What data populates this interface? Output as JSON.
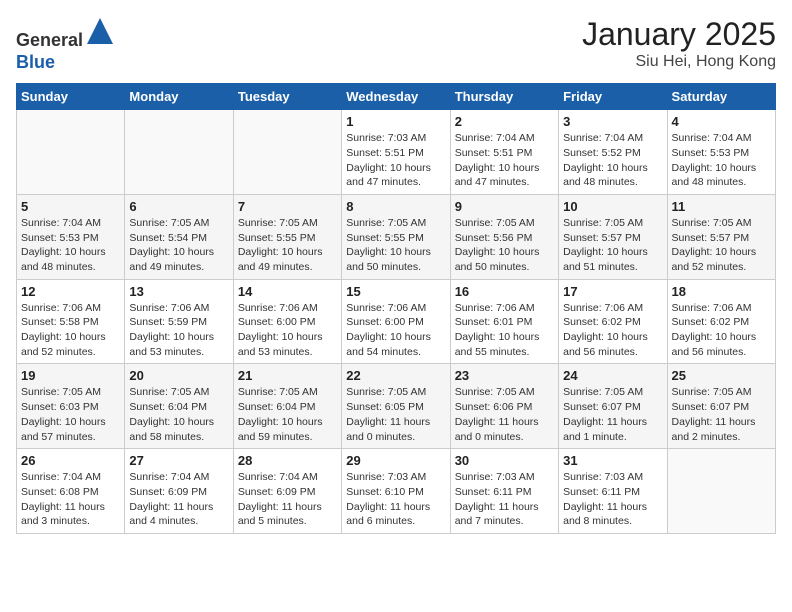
{
  "header": {
    "logo_line1": "General",
    "logo_line2": "Blue",
    "month": "January 2025",
    "location": "Siu Hei, Hong Kong"
  },
  "weekdays": [
    "Sunday",
    "Monday",
    "Tuesday",
    "Wednesday",
    "Thursday",
    "Friday",
    "Saturday"
  ],
  "weeks": [
    [
      {
        "day": "",
        "info": ""
      },
      {
        "day": "",
        "info": ""
      },
      {
        "day": "",
        "info": ""
      },
      {
        "day": "1",
        "info": "Sunrise: 7:03 AM\nSunset: 5:51 PM\nDaylight: 10 hours\nand 47 minutes."
      },
      {
        "day": "2",
        "info": "Sunrise: 7:04 AM\nSunset: 5:51 PM\nDaylight: 10 hours\nand 47 minutes."
      },
      {
        "day": "3",
        "info": "Sunrise: 7:04 AM\nSunset: 5:52 PM\nDaylight: 10 hours\nand 48 minutes."
      },
      {
        "day": "4",
        "info": "Sunrise: 7:04 AM\nSunset: 5:53 PM\nDaylight: 10 hours\nand 48 minutes."
      }
    ],
    [
      {
        "day": "5",
        "info": "Sunrise: 7:04 AM\nSunset: 5:53 PM\nDaylight: 10 hours\nand 48 minutes."
      },
      {
        "day": "6",
        "info": "Sunrise: 7:05 AM\nSunset: 5:54 PM\nDaylight: 10 hours\nand 49 minutes."
      },
      {
        "day": "7",
        "info": "Sunrise: 7:05 AM\nSunset: 5:55 PM\nDaylight: 10 hours\nand 49 minutes."
      },
      {
        "day": "8",
        "info": "Sunrise: 7:05 AM\nSunset: 5:55 PM\nDaylight: 10 hours\nand 50 minutes."
      },
      {
        "day": "9",
        "info": "Sunrise: 7:05 AM\nSunset: 5:56 PM\nDaylight: 10 hours\nand 50 minutes."
      },
      {
        "day": "10",
        "info": "Sunrise: 7:05 AM\nSunset: 5:57 PM\nDaylight: 10 hours\nand 51 minutes."
      },
      {
        "day": "11",
        "info": "Sunrise: 7:05 AM\nSunset: 5:57 PM\nDaylight: 10 hours\nand 52 minutes."
      }
    ],
    [
      {
        "day": "12",
        "info": "Sunrise: 7:06 AM\nSunset: 5:58 PM\nDaylight: 10 hours\nand 52 minutes."
      },
      {
        "day": "13",
        "info": "Sunrise: 7:06 AM\nSunset: 5:59 PM\nDaylight: 10 hours\nand 53 minutes."
      },
      {
        "day": "14",
        "info": "Sunrise: 7:06 AM\nSunset: 6:00 PM\nDaylight: 10 hours\nand 53 minutes."
      },
      {
        "day": "15",
        "info": "Sunrise: 7:06 AM\nSunset: 6:00 PM\nDaylight: 10 hours\nand 54 minutes."
      },
      {
        "day": "16",
        "info": "Sunrise: 7:06 AM\nSunset: 6:01 PM\nDaylight: 10 hours\nand 55 minutes."
      },
      {
        "day": "17",
        "info": "Sunrise: 7:06 AM\nSunset: 6:02 PM\nDaylight: 10 hours\nand 56 minutes."
      },
      {
        "day": "18",
        "info": "Sunrise: 7:06 AM\nSunset: 6:02 PM\nDaylight: 10 hours\nand 56 minutes."
      }
    ],
    [
      {
        "day": "19",
        "info": "Sunrise: 7:05 AM\nSunset: 6:03 PM\nDaylight: 10 hours\nand 57 minutes."
      },
      {
        "day": "20",
        "info": "Sunrise: 7:05 AM\nSunset: 6:04 PM\nDaylight: 10 hours\nand 58 minutes."
      },
      {
        "day": "21",
        "info": "Sunrise: 7:05 AM\nSunset: 6:04 PM\nDaylight: 10 hours\nand 59 minutes."
      },
      {
        "day": "22",
        "info": "Sunrise: 7:05 AM\nSunset: 6:05 PM\nDaylight: 11 hours\nand 0 minutes."
      },
      {
        "day": "23",
        "info": "Sunrise: 7:05 AM\nSunset: 6:06 PM\nDaylight: 11 hours\nand 0 minutes."
      },
      {
        "day": "24",
        "info": "Sunrise: 7:05 AM\nSunset: 6:07 PM\nDaylight: 11 hours\nand 1 minute."
      },
      {
        "day": "25",
        "info": "Sunrise: 7:05 AM\nSunset: 6:07 PM\nDaylight: 11 hours\nand 2 minutes."
      }
    ],
    [
      {
        "day": "26",
        "info": "Sunrise: 7:04 AM\nSunset: 6:08 PM\nDaylight: 11 hours\nand 3 minutes."
      },
      {
        "day": "27",
        "info": "Sunrise: 7:04 AM\nSunset: 6:09 PM\nDaylight: 11 hours\nand 4 minutes."
      },
      {
        "day": "28",
        "info": "Sunrise: 7:04 AM\nSunset: 6:09 PM\nDaylight: 11 hours\nand 5 minutes."
      },
      {
        "day": "29",
        "info": "Sunrise: 7:03 AM\nSunset: 6:10 PM\nDaylight: 11 hours\nand 6 minutes."
      },
      {
        "day": "30",
        "info": "Sunrise: 7:03 AM\nSunset: 6:11 PM\nDaylight: 11 hours\nand 7 minutes."
      },
      {
        "day": "31",
        "info": "Sunrise: 7:03 AM\nSunset: 6:11 PM\nDaylight: 11 hours\nand 8 minutes."
      },
      {
        "day": "",
        "info": ""
      }
    ]
  ]
}
